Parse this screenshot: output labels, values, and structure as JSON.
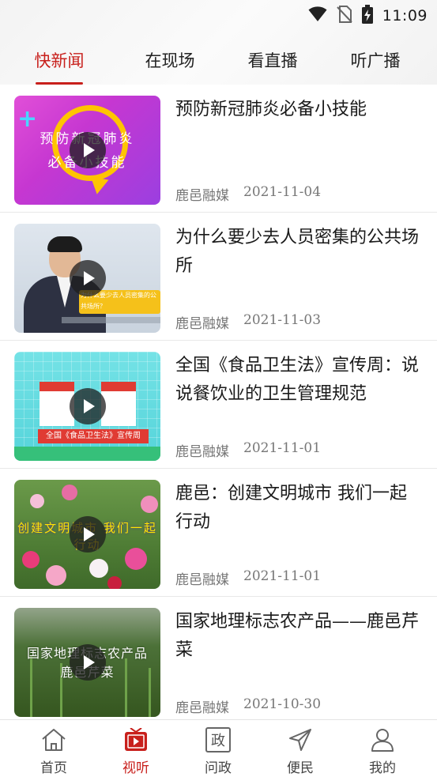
{
  "status_bar": {
    "time": "11:09",
    "icons": [
      "wifi-icon",
      "no-sim-icon",
      "battery-charging-icon"
    ]
  },
  "tabs": [
    {
      "label": "快新闻",
      "active": true
    },
    {
      "label": "在现场",
      "active": false
    },
    {
      "label": "看直播",
      "active": false
    },
    {
      "label": "听广播",
      "active": false
    }
  ],
  "news": [
    {
      "title": "预防新冠肺炎必备小技能",
      "source": "鹿邑融媒",
      "date": "2021-11-04",
      "thumb_text_line1": "预防新冠肺炎",
      "thumb_text_line2": "必备小技能"
    },
    {
      "title": "为什么要少去人员密集的公共场所",
      "source": "鹿邑融媒",
      "date": "2021-11-03",
      "thumb_text": "为什么要少去人员密集的公共场所？"
    },
    {
      "title": "全国《食品卫生法》宣传周：说说餐饮业的卫生管理规范",
      "source": "鹿邑融媒",
      "date": "2021-11-01",
      "thumb_text": "全国《食品卫生法》宣传周"
    },
    {
      "title": "鹿邑：创建文明城市 我们一起行动",
      "source": "鹿邑融媒",
      "date": "2021-11-01",
      "thumb_text": "创建文明城市 我们一起行动"
    },
    {
      "title": "国家地理标志农产品——鹿邑芹菜",
      "source": "鹿邑融媒",
      "date": "2021-10-30",
      "thumb_text_line1": "国家地理标志农产品",
      "thumb_text_line2": "鹿邑芹菜"
    }
  ],
  "bottom_nav": [
    {
      "label": "首页",
      "icon": "home-icon",
      "active": false
    },
    {
      "label": "视听",
      "icon": "video-tv-icon",
      "active": true
    },
    {
      "label": "问政",
      "icon": "politics-icon",
      "icon_glyph": "政",
      "active": false
    },
    {
      "label": "便民",
      "icon": "send-icon",
      "active": false
    },
    {
      "label": "我的",
      "icon": "user-icon",
      "active": false
    }
  ],
  "colors": {
    "accent": "#c8201c",
    "text": "#1a1a1a",
    "meta": "#777777"
  }
}
